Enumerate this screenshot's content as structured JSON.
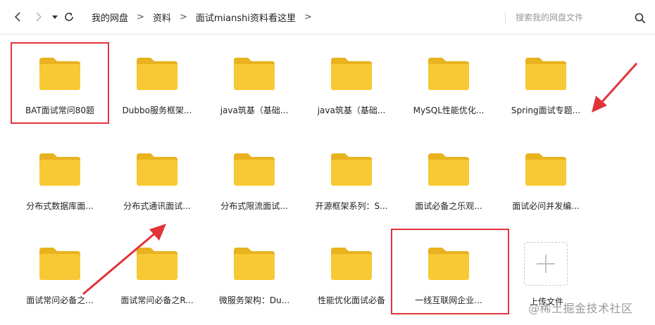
{
  "toolbar": {
    "back_icon": "chevron-left-icon",
    "forward_icon": "chevron-right-icon",
    "history_dropdown_icon": "caret-down-icon",
    "refresh_icon": "refresh-icon",
    "breadcrumb": [
      "我的网盘",
      "资料",
      "面试mianshi资料看这里"
    ],
    "breadcrumb_separator": ">",
    "search_placeholder": "搜索我的网盘文件",
    "search_icon": "search-icon"
  },
  "folders": [
    {
      "label": "BAT面试常问80题",
      "highlighted": true
    },
    {
      "label": "Dubbo服务框架...",
      "highlighted": false
    },
    {
      "label": "java筑基（基础...",
      "highlighted": false
    },
    {
      "label": "java筑基（基础...",
      "highlighted": false
    },
    {
      "label": "MySQL性能优化...",
      "highlighted": false
    },
    {
      "label": "Spring面试专题...",
      "highlighted": false
    },
    {
      "label": "分布式数据库面...",
      "highlighted": false
    },
    {
      "label": "分布式通讯面试...",
      "highlighted": false
    },
    {
      "label": "分布式限流面试...",
      "highlighted": false
    },
    {
      "label": "开源框架系列：S...",
      "highlighted": false
    },
    {
      "label": "面试必备之乐观...",
      "highlighted": false
    },
    {
      "label": "面试必问并发编...",
      "highlighted": false
    },
    {
      "label": "面试常问必备之...",
      "highlighted": false
    },
    {
      "label": "面试常问必备之R...",
      "highlighted": false
    },
    {
      "label": "微服务架构：Du...",
      "highlighted": false
    },
    {
      "label": "性能优化面试必备",
      "highlighted": false
    },
    {
      "label": "一线互联网企业...",
      "highlighted": true
    }
  ],
  "upload": {
    "label": "上传文件",
    "icon": "plus-icon"
  },
  "annotations": {
    "highlight_color": "#e2333b",
    "arrow_color": "#e2333b"
  },
  "folder_colors": {
    "body": "#f7c934",
    "tab": "#e9b21f"
  },
  "watermark": "@稀土掘金技术社区"
}
